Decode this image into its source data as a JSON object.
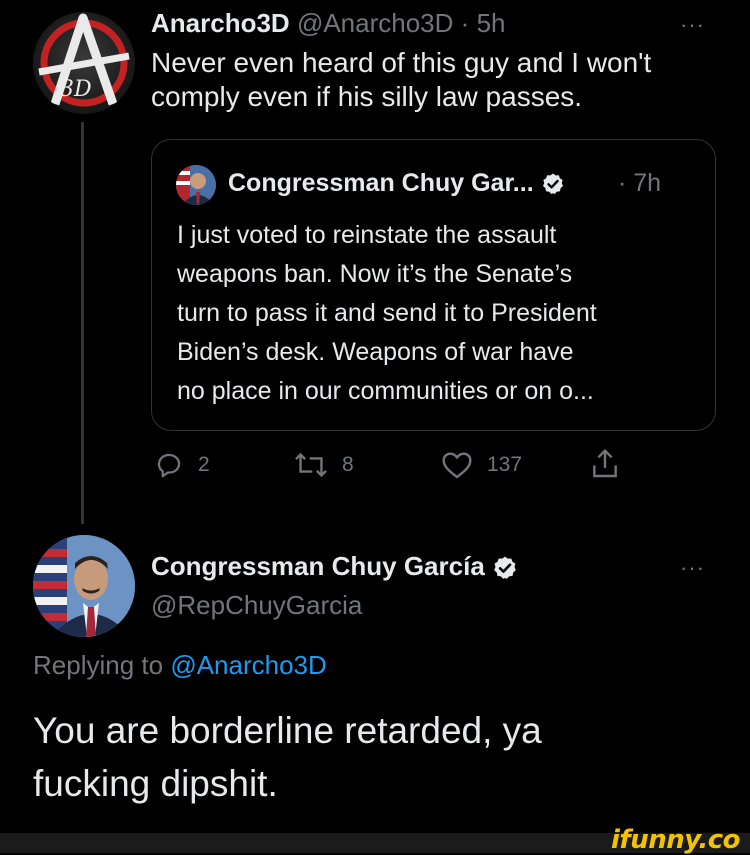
{
  "main_tweet": {
    "display_name": "Anarcho3D",
    "handle": "@Anarcho3D",
    "separator": "·",
    "time": "5h",
    "more_label": "···",
    "text_line1": "Never even heard of this guy and I won't",
    "text_line2": "comply even if his silly law passes.",
    "avatar_text": "3D"
  },
  "quoted_tweet": {
    "display_name": "Congressman Chuy Gar...",
    "time": "· 7h",
    "lines": [
      "I just voted to reinstate the assault",
      "weapons ban. Now it’s the Senate’s",
      "turn to pass it and send it to President",
      "Biden’s desk. Weapons of war have",
      "no place in our communities or on o..."
    ]
  },
  "actions": {
    "reply_count": "2",
    "retweet_count": "8",
    "like_count": "137"
  },
  "reply_tweet": {
    "display_name": "Congressman Chuy García",
    "handle": "@RepChuyGarcia",
    "more_label": "···",
    "replying_prefix": "Replying to",
    "replying_handle": "@Anarcho3D",
    "text_line1": "You are borderline retarded, ya",
    "text_line2": "fucking dipshit."
  },
  "watermark": "ifunny.co",
  "colors": {
    "background": "#000000",
    "text": "#e7e9ea",
    "muted": "#71767b",
    "link": "#1d9bf0",
    "verified": "#e7e9ea",
    "watermark": "#f4c300"
  },
  "icons": {
    "reply": "reply-icon",
    "retweet": "retweet-icon",
    "like": "heart-icon",
    "share": "share-icon",
    "verified": "verified-badge-icon",
    "more": "more-icon"
  }
}
